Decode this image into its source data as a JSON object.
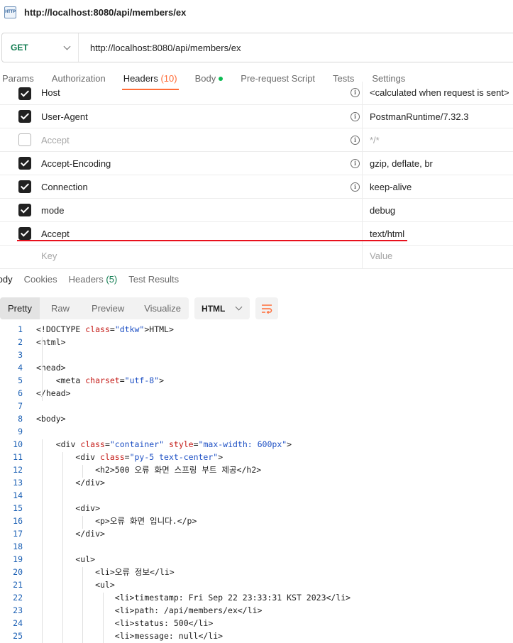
{
  "window": {
    "icon_label": "HTTP",
    "title": "http://localhost:8080/api/members/ex"
  },
  "request": {
    "method": "GET",
    "url": "http://localhost:8080/api/members/ex"
  },
  "request_tabs": [
    {
      "label": "Params"
    },
    {
      "label": "Authorization"
    },
    {
      "label": "Headers",
      "count": "(10)",
      "active": true
    },
    {
      "label": "Body",
      "has_dot": true
    },
    {
      "label": "Pre-request Script"
    },
    {
      "label": "Tests"
    },
    {
      "label": "Settings"
    }
  ],
  "headers": [
    {
      "key": "Host",
      "value": "<calculated when request is sent>",
      "checked": true,
      "info": true
    },
    {
      "key": "User-Agent",
      "value": "PostmanRuntime/7.32.3",
      "checked": true,
      "info": true
    },
    {
      "key": "Accept",
      "value": "*/*",
      "checked": false,
      "info": true
    },
    {
      "key": "Accept-Encoding",
      "value": "gzip, deflate, br",
      "checked": true,
      "info": true
    },
    {
      "key": "Connection",
      "value": "keep-alive",
      "checked": true,
      "info": true
    },
    {
      "key": "mode",
      "value": "debug",
      "checked": true,
      "info": false
    },
    {
      "key": "Accept",
      "value": "text/html",
      "checked": true,
      "info": false
    }
  ],
  "new_header": {
    "key_placeholder": "Key",
    "value_placeholder": "Value"
  },
  "response_tabs": [
    {
      "label": "Body",
      "active": true
    },
    {
      "label": "Cookies"
    },
    {
      "label": "Headers",
      "count": "(5)"
    },
    {
      "label": "Test Results"
    }
  ],
  "view_modes": [
    "Pretty",
    "Raw",
    "Preview",
    "Visualize"
  ],
  "active_view": "Pretty",
  "format": "HTML",
  "code_lines": [
    "<!DOCTYPE HTML>",
    "<html>",
    "",
    "<head>",
    "    <meta charset=\"utf-8\">",
    "</head>",
    "",
    "<body>",
    "",
    "    <div class=\"container\" style=\"max-width: 600px\">",
    "        <div class=\"py-5 text-center\">",
    "            <h2>500 오류 화면 스프링 부트 제공</h2>",
    "        </div>",
    "",
    "        <div>",
    "            <p>오류 화면 입니다.</p>",
    "        </div>",
    "",
    "        <ul>",
    "            <li>오류 정보</li>",
    "            <ul>",
    "                <li>timestamp: Fri Sep 22 23:33:31 KST 2023</li>",
    "                <li>path: /api/members/ex</li>",
    "                <li>status: 500</li>",
    "                <li>message: null</li>"
  ],
  "icons": {
    "method_dropdown": "chevron-down-icon",
    "format_dropdown": "chevron-down-icon",
    "wrap": "wrap-lines-icon",
    "info": "info-icon",
    "checkbox": "checkbox-icon"
  },
  "colors": {
    "accent": "#ff6c37",
    "method_get": "#0f7b4f",
    "annotation_line": "#e8111d",
    "body_dot": "#0cbb52"
  }
}
